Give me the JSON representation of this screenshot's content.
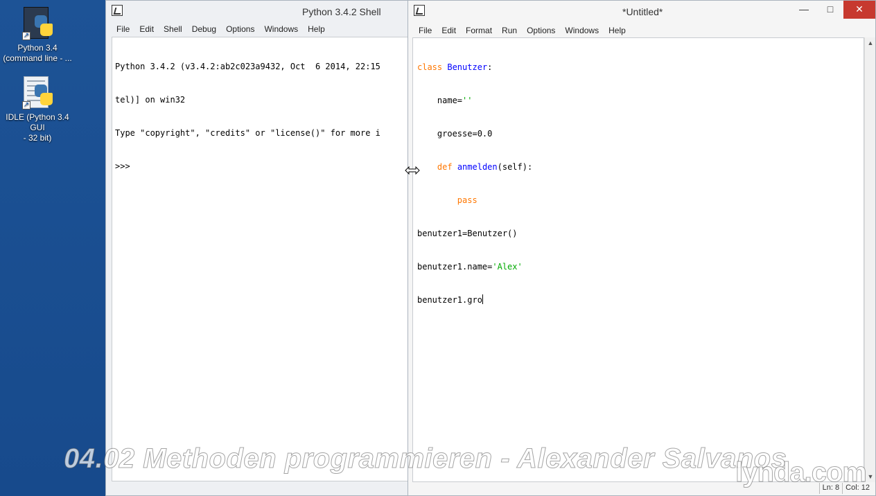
{
  "desktop": {
    "icons": [
      {
        "label": "Python 3.4\n(command line - ..."
      },
      {
        "label": "IDLE (Python 3.4 GUI\n- 32 bit)"
      }
    ]
  },
  "shell": {
    "title": "Python 3.4.2 Shell",
    "menu": [
      "File",
      "Edit",
      "Shell",
      "Debug",
      "Options",
      "Windows",
      "Help"
    ],
    "lines": [
      "Python 3.4.2 (v3.4.2:ab2c023a9432, Oct  6 2014, 22:15",
      "tel)] on win32",
      "Type \"copyright\", \"credits\" or \"license()\" for more i",
      ">>>"
    ]
  },
  "editor": {
    "title": "*Untitled*",
    "menu": [
      "File",
      "Edit",
      "Format",
      "Run",
      "Options",
      "Windows",
      "Help"
    ],
    "code": {
      "l1_kw": "class",
      "l1_name": "Benutzer",
      "l1_rest": ":",
      "l2_a": "    name=",
      "l2_str": "''",
      "l3": "    groesse=0.0",
      "l4_kw": "def",
      "l4_name": "anmelden",
      "l4_rest": "(self):",
      "l5_kw": "pass",
      "l6": "benutzer1=Benutzer()",
      "l7_a": "benutzer1.name=",
      "l7_str": "'Alex'",
      "l8": "benutzer1.gro"
    },
    "status": {
      "line": "Ln: 8",
      "col": "Col: 12"
    }
  },
  "overlay": {
    "course_title": "04.02 Methoden programmieren - Alexander Salvanos",
    "logo": "lynda.com"
  },
  "colors": {
    "keyword": "#ff7700",
    "definition": "#0000ff",
    "string": "#00aa00"
  }
}
